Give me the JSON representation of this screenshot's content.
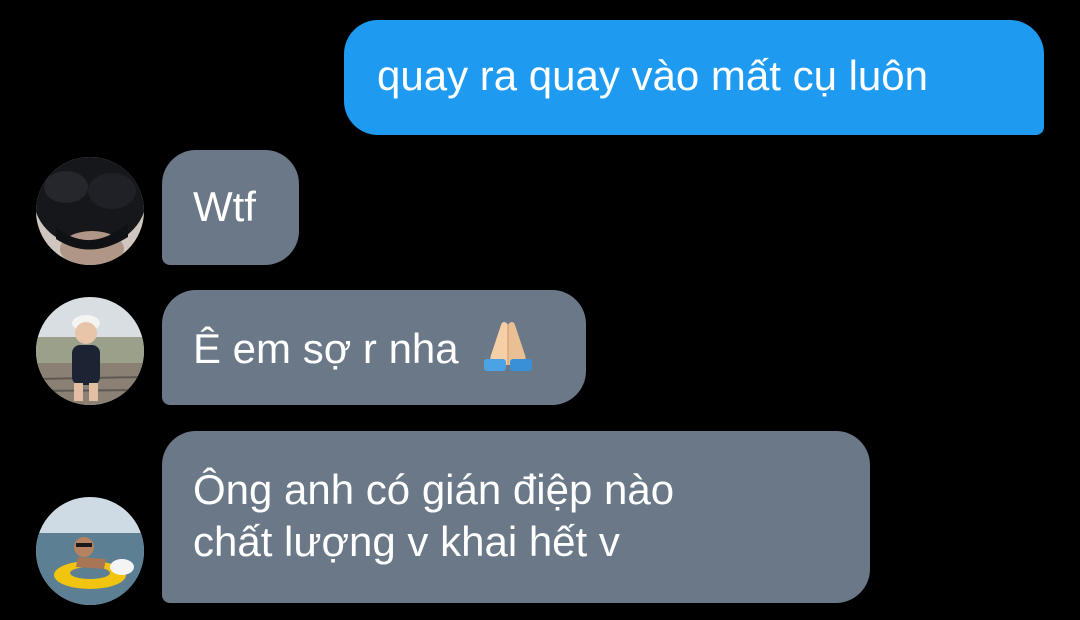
{
  "conversation": {
    "messages": [
      {
        "direction": "outgoing",
        "lines": [
          "quay ra quay vào mất cụ luôn"
        ]
      },
      {
        "direction": "incoming",
        "avatar": "dark-hair-avatar",
        "lines": [
          "Wtf"
        ]
      },
      {
        "direction": "incoming",
        "avatar": "child-cap-avatar",
        "lines": [
          "Ê em sợ r nha"
        ],
        "emoji": "folded-hands-icon"
      },
      {
        "direction": "incoming",
        "avatar": "beach-float-avatar",
        "lines": [
          "Ông anh có gián điệp nào",
          "chất lượng v khai hết v"
        ]
      }
    ]
  },
  "colors": {
    "background": "#000000",
    "outgoing_bubble": "#1e9bf0",
    "incoming_bubble": "#6b7888",
    "text": "#ffffff"
  }
}
